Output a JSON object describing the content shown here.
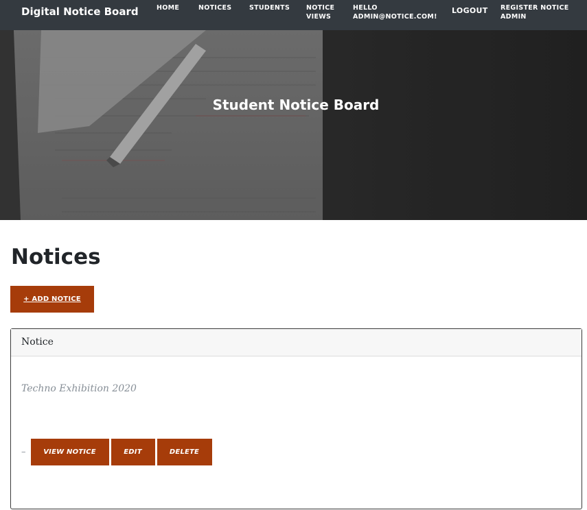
{
  "navbar": {
    "brand": "Digital Notice Board",
    "links": {
      "home": "HOME",
      "notices": "NOTICES",
      "students": "STUDENTS",
      "notice_views_line1": "NOTICE",
      "notice_views_line2": "VIEWS",
      "hello_line1": "HELLO",
      "hello_line2": "ADMIN@NOTICE.COM!",
      "logout": "LOGOUT",
      "register_line1": "REGISTER NOTICE",
      "register_line2": "ADMIN"
    }
  },
  "hero": {
    "title": "Student Notice Board"
  },
  "main": {
    "page_title": "Notices",
    "add_button": "+ ADD NOTICE",
    "card": {
      "header": "Notice",
      "notice_title": "Techno Exhibition 2020",
      "dash": "–",
      "view_button": "VIEW NOTICE",
      "edit_button": "EDIT",
      "delete_button": "DELETE"
    }
  },
  "colors": {
    "navbar_bg": "#343a40",
    "accent": "#a63c0a",
    "muted_text": "#868e96"
  }
}
